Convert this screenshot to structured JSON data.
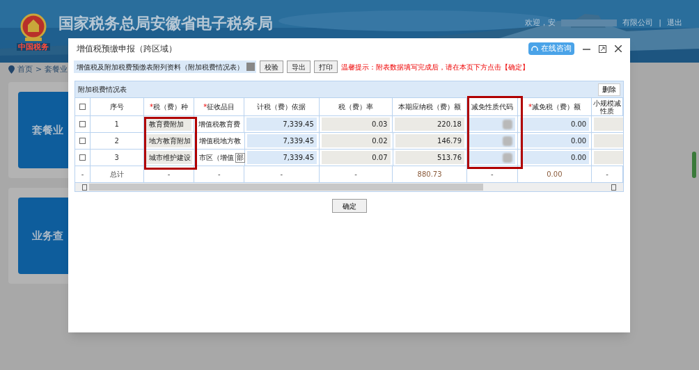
{
  "header": {
    "title": "国家税务总局安徽省电子税务局",
    "logo_caption": "中国税务",
    "welcome": "欢迎，安",
    "company": "有限公司",
    "separator": "|",
    "logout": "退出"
  },
  "breadcrumb": {
    "home": "首页",
    "separator": ">",
    "current": "套餐业"
  },
  "tiles": [
    {
      "label": "套餐业"
    },
    {
      "label": "业务查"
    }
  ],
  "dialog": {
    "title": "增值税预缴申报（跨区域）",
    "consult": "在线咨询",
    "toolbar": {
      "select_value": "增值税及附加税费预缴表附列资料（附加税费情况表）",
      "buttons": [
        "校验",
        "导出",
        "打印"
      ],
      "notice": "温馨提示：附表数据填写完成后，请在本页下方点击【确定】"
    },
    "panel_title": "附加税费情况表",
    "delete_button": "删除",
    "select_all_checked": false,
    "columns": [
      {
        "label": "序号"
      },
      {
        "label": "税（费）种",
        "required_mark": "*"
      },
      {
        "label": "征收品目",
        "required_mark": "*"
      },
      {
        "label": "计税（费）依据"
      },
      {
        "label": "税（费）率"
      },
      {
        "label": "本期应纳税（费）额"
      },
      {
        "label": "减免性质代码"
      },
      {
        "label": "减免税（费）额",
        "required_mark": "*"
      },
      {
        "label": "小规模减",
        "label_line2": "性质"
      }
    ],
    "rows": [
      {
        "checked": false,
        "seq": "1",
        "tax_type": "教育费附加",
        "item": "增值税教育费",
        "basis": "7,339.45",
        "rate": "0.03",
        "amount": "220.18",
        "relief": "0.00"
      },
      {
        "checked": false,
        "seq": "2",
        "tax_type": "地方教育附加",
        "item": "增值税地方教",
        "basis": "7,339.45",
        "rate": "0.02",
        "amount": "146.79",
        "relief": "0.00"
      },
      {
        "checked": false,
        "seq": "3",
        "tax_type": "城市维护建设",
        "item": "市区（增值",
        "item_marker": "部",
        "basis": "7,339.45",
        "rate": "0.07",
        "amount": "513.76",
        "relief": "0.00"
      }
    ],
    "totals": [
      "-",
      "总计",
      "-",
      "-",
      "-",
      "-",
      "880.73",
      "-",
      "0.00",
      "-"
    ],
    "confirm": "确定"
  }
}
